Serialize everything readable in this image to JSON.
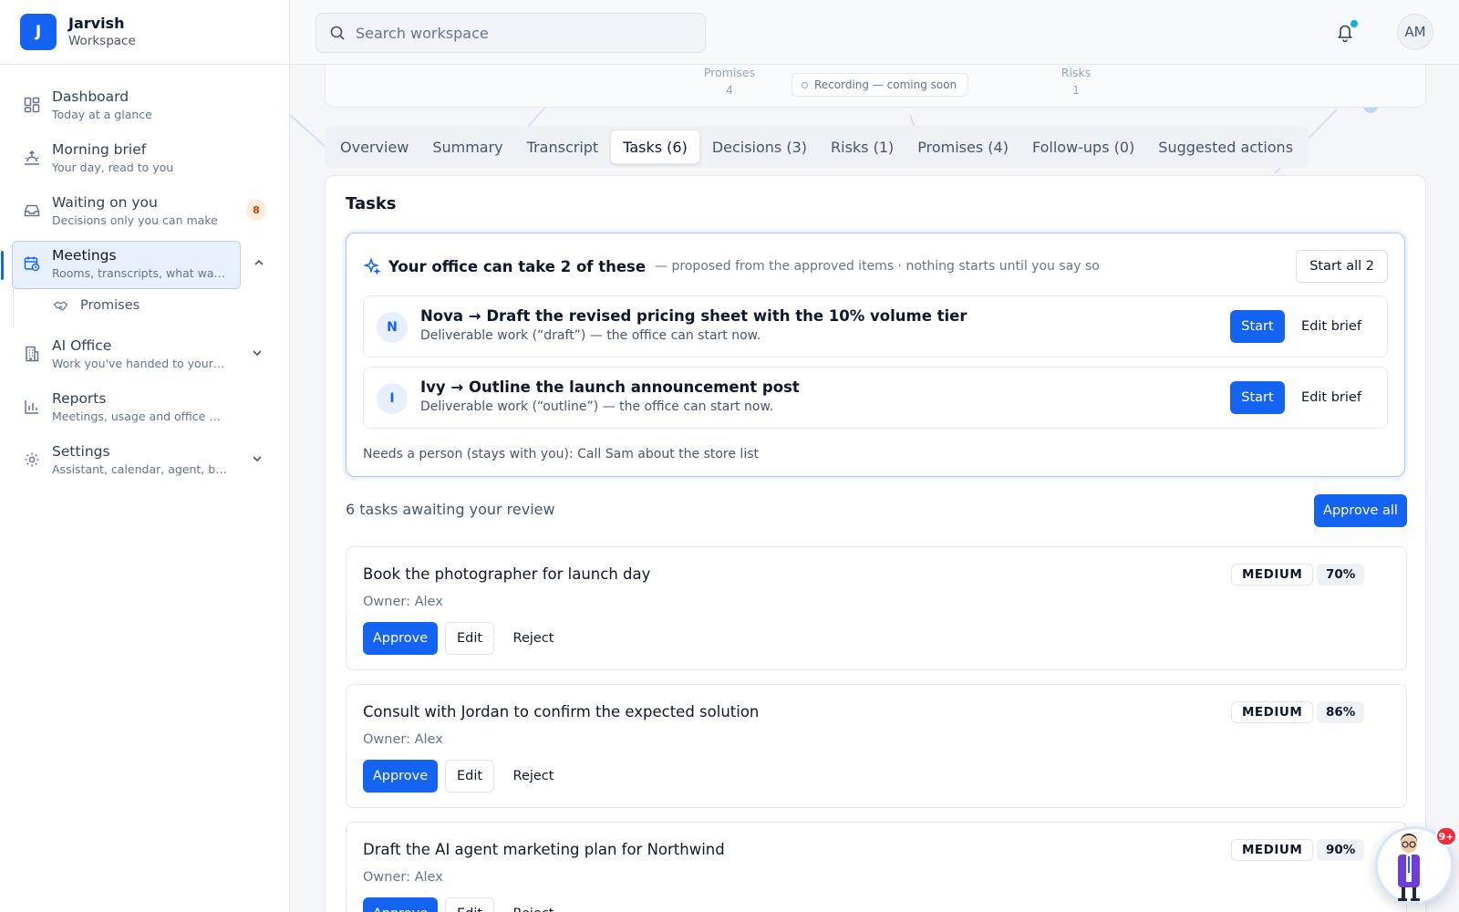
{
  "brand": {
    "initial": "J",
    "name": "Jarvish",
    "sub": "Workspace"
  },
  "search": {
    "placeholder": "Search workspace"
  },
  "user": {
    "initials": "AM"
  },
  "sidebar": {
    "items": [
      {
        "title": "Dashboard",
        "sub": "Today at a glance",
        "icon": "dashboard-icon"
      },
      {
        "title": "Morning brief",
        "sub": "Your day, read to you",
        "icon": "sunrise-icon"
      },
      {
        "title": "Waiting on you",
        "sub": "Decisions only you can make",
        "icon": "inbox-icon",
        "badge": "8"
      },
      {
        "title": "Meetings",
        "sub": "Rooms, transcripts, what was…",
        "icon": "calendar-clock-icon",
        "active": true
      },
      {
        "title": "AI Office",
        "sub": "Work you've handed to your …",
        "icon": "building-icon"
      },
      {
        "title": "Reports",
        "sub": "Meetings, usage and office activity",
        "icon": "bar-chart-icon"
      },
      {
        "title": "Settings",
        "sub": "Assistant, calendar, agent, bil…",
        "icon": "gear-icon"
      }
    ],
    "subitem": {
      "label": "Promises",
      "icon": "handshake-icon"
    }
  },
  "background": {
    "promises_label": "Promises",
    "promises_value": "4",
    "risks_label": "Risks",
    "risks_value": "1",
    "recording": "Recording — coming soon"
  },
  "tabs": [
    {
      "label": "Overview"
    },
    {
      "label": "Summary"
    },
    {
      "label": "Transcript"
    },
    {
      "label": "Tasks (6)",
      "active": true
    },
    {
      "label": "Decisions (3)"
    },
    {
      "label": "Risks (1)"
    },
    {
      "label": "Promises (4)"
    },
    {
      "label": "Follow-ups (0)"
    },
    {
      "label": "Suggested actions"
    }
  ],
  "tasks_panel": {
    "title": "Tasks",
    "office": {
      "title": "Your office can take 2 of these",
      "desc": "— proposed from the approved items · nothing starts until you say so",
      "start_all": "Start all 2",
      "agents": [
        {
          "initial": "N",
          "title": "Nova → Draft the revised pricing sheet with the 10% volume tier",
          "sub": "Deliverable work (“draft”) — the office can start now.",
          "start": "Start",
          "edit": "Edit brief"
        },
        {
          "initial": "I",
          "title": "Ivy → Outline the launch announcement post",
          "sub": "Deliverable work (“outline”) — the office can start now.",
          "start": "Start",
          "edit": "Edit brief"
        }
      ],
      "needs_person": "Needs a person (stays with you): Call Sam about the store list"
    },
    "review_heading": "6 tasks awaiting your review",
    "approve_all": "Approve all",
    "tasks": [
      {
        "title": "Book the photographer for launch day",
        "owner": "Owner: Alex",
        "priority": "MEDIUM",
        "confidence": "70%",
        "approve": "Approve",
        "edit": "Edit",
        "reject": "Reject"
      },
      {
        "title": "Consult with Jordan to confirm the expected solution",
        "owner": "Owner: Alex",
        "priority": "MEDIUM",
        "confidence": "86%",
        "approve": "Approve",
        "edit": "Edit",
        "reject": "Reject"
      },
      {
        "title": "Draft the AI agent marketing plan for Northwind",
        "owner": "Owner: Alex",
        "priority": "MEDIUM",
        "confidence": "90%",
        "approve": "Approve",
        "edit": "Edit",
        "reject": "Reject"
      }
    ]
  },
  "assistant": {
    "badge": "9+"
  },
  "colors": {
    "accent": "#1463f3",
    "badge_bg": "#fdecd8",
    "notification_dot": "#06b6d4",
    "alert": "#ef2b3b"
  }
}
